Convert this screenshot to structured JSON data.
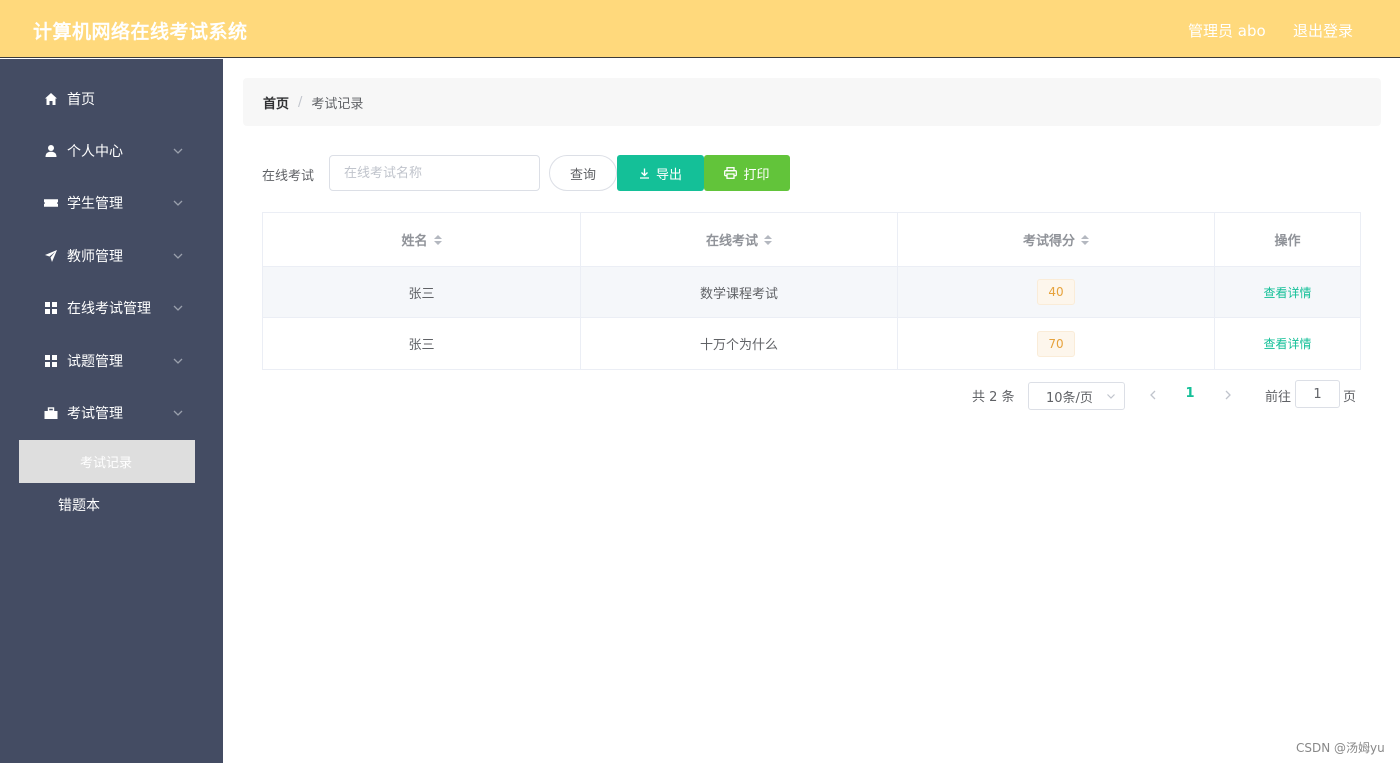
{
  "header": {
    "title": "计算机网络在线考试系统",
    "user": "管理员 abo",
    "logout": "退出登录",
    "bg_color": "#ffd97c"
  },
  "sidebar": {
    "bg_color": "#444c63",
    "items": [
      {
        "label": "首页",
        "icon": "home-icon"
      },
      {
        "label": "个人中心",
        "icon": "user-icon"
      },
      {
        "label": "学生管理",
        "icon": "ticket-icon"
      },
      {
        "label": "教师管理",
        "icon": "paper-plane-icon"
      },
      {
        "label": "在线考试管理",
        "icon": "grid-icon"
      },
      {
        "label": "试题管理",
        "icon": "grid-icon"
      },
      {
        "label": "考试管理",
        "icon": "briefcase-icon"
      }
    ],
    "sub_items": [
      {
        "label": "考试记录",
        "active": true
      },
      {
        "label": "错题本",
        "active": false
      }
    ]
  },
  "breadcrumb": {
    "home": "首页",
    "separator": "/",
    "current": "考试记录"
  },
  "search": {
    "label": "在线考试",
    "placeholder": "在线考试名称",
    "query_button": "查询",
    "export_button": "导出",
    "print_button": "打印"
  },
  "table": {
    "columns": [
      "姓名",
      "在线考试",
      "考试得分",
      "操作"
    ],
    "rows": [
      {
        "name": "张三",
        "exam": "数学课程考试",
        "score": "40",
        "action": "查看详情"
      },
      {
        "name": "张三",
        "exam": "十万个为什么",
        "score": "70",
        "action": "查看详情"
      }
    ]
  },
  "pagination": {
    "total": "共 2 条",
    "page_size": "10条/页",
    "current_page": "1",
    "goto_label": "前往",
    "goto_value": "1",
    "page_suffix": "页"
  },
  "watermark": "CSDN @汤姆yu",
  "accent_color": "#14c098"
}
